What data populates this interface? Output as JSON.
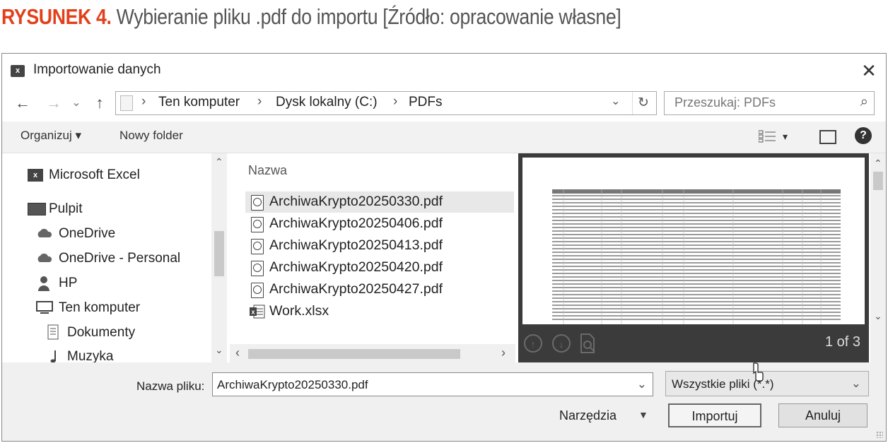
{
  "caption": {
    "label": "RYSUNEK 4.",
    "text": " Wybieranie pliku .pdf do importu [Źródło: opracowanie własne]"
  },
  "dialog": {
    "app_icon_text": "x",
    "title": "Importowanie danych",
    "close_glyph": "✕"
  },
  "address": {
    "back": "←",
    "forward": "→",
    "recent": "⌄",
    "up": "↑",
    "crumbs": [
      "Ten komputer",
      "Dysk lokalny (C:)",
      "PDFs"
    ],
    "separator": "›",
    "dropdown": "⌄",
    "refresh": "↻"
  },
  "search": {
    "placeholder": "Przeszukaj: PDFs",
    "icon": "⌕"
  },
  "toolbar": {
    "organize": "Organizuj ▾",
    "new_folder": "Nowy folder",
    "view_dd": "▾",
    "help": "?"
  },
  "nav_pane": {
    "items": [
      {
        "label": "Microsoft Excel",
        "icon": "excel-icon"
      },
      {
        "label": "Pulpit",
        "icon": "desktop-icon"
      },
      {
        "label": "OneDrive",
        "icon": "cloud-icon"
      },
      {
        "label": "OneDrive - Personal",
        "icon": "cloud-icon"
      },
      {
        "label": "HP",
        "icon": "user-icon"
      },
      {
        "label": "Ten komputer",
        "icon": "computer-icon"
      },
      {
        "label": "Dokumenty",
        "icon": "document-icon"
      },
      {
        "label": "Muzyka",
        "icon": "music-icon"
      }
    ],
    "scroll_up": "⌃",
    "scroll_down": "⌄"
  },
  "file_list": {
    "column_header": "Nazwa",
    "files": [
      {
        "name": "ArchiwaKrypto20250330.pdf",
        "type": "pdf",
        "selected": true
      },
      {
        "name": "ArchiwaKrypto20250406.pdf",
        "type": "pdf"
      },
      {
        "name": "ArchiwaKrypto20250413.pdf",
        "type": "pdf"
      },
      {
        "name": "ArchiwaKrypto20250420.pdf",
        "type": "pdf"
      },
      {
        "name": "ArchiwaKrypto20250427.pdf",
        "type": "pdf"
      },
      {
        "name": "Work.xlsx",
        "type": "xlsx"
      }
    ],
    "scroll_left": "‹",
    "scroll_right": "›"
  },
  "preview": {
    "page_count": "1 of 3",
    "scroll_up": "⌃",
    "scroll_down": "⌄"
  },
  "bottom": {
    "filename_label": "Nazwa pliku:",
    "filename_value": "ArchiwaKrypto20250330.pdf",
    "filename_dd": "⌄",
    "filetype_value": "Wszystkie pliki (*.*)",
    "filetype_dd": "⌄",
    "tools_label": "Narzędzia",
    "tools_dd": "▼",
    "import_button": "Importuj",
    "cancel_button": "Anuluj"
  }
}
